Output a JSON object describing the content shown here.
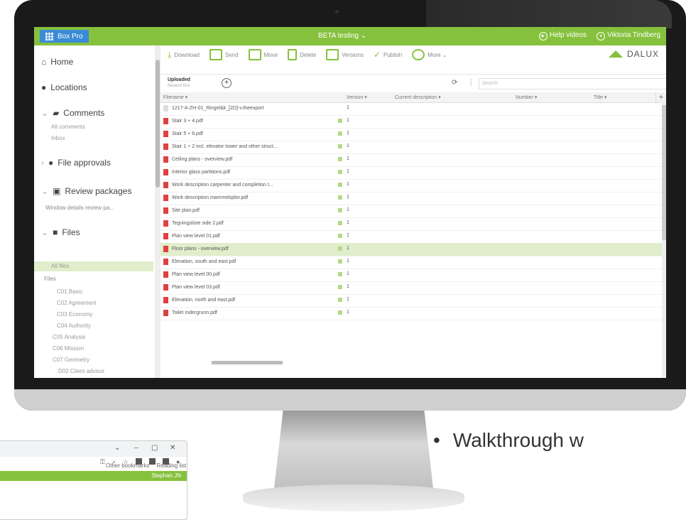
{
  "topbar": {
    "app_label": "Box Pro",
    "project": "BETA testing ⌄",
    "help_label": "Help videos",
    "user_name": "Viktoria Tindberg"
  },
  "sidebar": {
    "home": "Home",
    "locations": "Locations",
    "comments": "Comments",
    "all_comments": "All comments",
    "inbox": "Inbox",
    "file_approvals": "File approvals",
    "review_packages": "Review packages",
    "window_details": "Window details review pa...",
    "files": "Files",
    "all_files": "All files",
    "files_folder": "Files",
    "folders": [
      "C01 Basic",
      "C02 Agreement",
      "C03 Economy",
      "C04 Authority",
      "C05 Analysis",
      "C06 Mission",
      "C07 Geometry"
    ],
    "sub_folder": "D02 Client advisor"
  },
  "toolbar": {
    "download": "Download",
    "send": "Send",
    "move": "Move",
    "delete": "Delete",
    "versions": "Versions",
    "publish": "Publish",
    "more": "More ⌄"
  },
  "brand": "DALUX",
  "subbar": {
    "uploaded": "Uploaded",
    "uploaded_sub": "Newest first",
    "search_placeholder": "Search"
  },
  "columns": {
    "filename": "Filename ▾",
    "version": "Version ▾",
    "description": "Current description ▾",
    "number": "Number ▾",
    "title": "Title ▾"
  },
  "files": [
    {
      "name": "1217-A-ZH-01_Ringel&k_[2D]-v.theexport",
      "version": "1"
    },
    {
      "name": "Stair 3 + 4.pdf",
      "version": "1"
    },
    {
      "name": "Stair 5 + 6.pdf",
      "version": "1"
    },
    {
      "name": "Stair 1 + 2 incl. elevator tower and other struct...",
      "version": "1"
    },
    {
      "name": "Ceiling plans - overview.pdf",
      "version": "1"
    },
    {
      "name": "Interior glass partitions.pdf",
      "version": "1"
    },
    {
      "name": "Work description carpenter and completion t...",
      "version": "1"
    },
    {
      "name": "Work description mammelsjdor.pdf",
      "version": "1"
    },
    {
      "name": "Site plan.pdf",
      "version": "1"
    },
    {
      "name": "Tegningsliste side 2.pdf",
      "version": "1"
    },
    {
      "name": "Plan view level 01.pdf",
      "version": "1"
    },
    {
      "name": "Floor plans - overview.pdf",
      "version": "1"
    },
    {
      "name": "Elevation, south and east.pdf",
      "version": "1"
    },
    {
      "name": "Plan view level 00.pdf",
      "version": "1"
    },
    {
      "name": "Plan view level 03.pdf",
      "version": "1"
    },
    {
      "name": "Elevation, north and east.pdf",
      "version": "1"
    },
    {
      "name": "Toilet Indergrunn.pdf",
      "version": "1"
    }
  ],
  "bullet_text": "Walkthrough w",
  "browser": {
    "bookmarks": "Other bookmarks",
    "reading_list": "Reading list",
    "stephan": "Stephan JN"
  },
  "colors": {
    "green": "#86c13d",
    "blue": "#3a8bd6",
    "selected": "#e0eecb",
    "pdf": "#e04040"
  }
}
